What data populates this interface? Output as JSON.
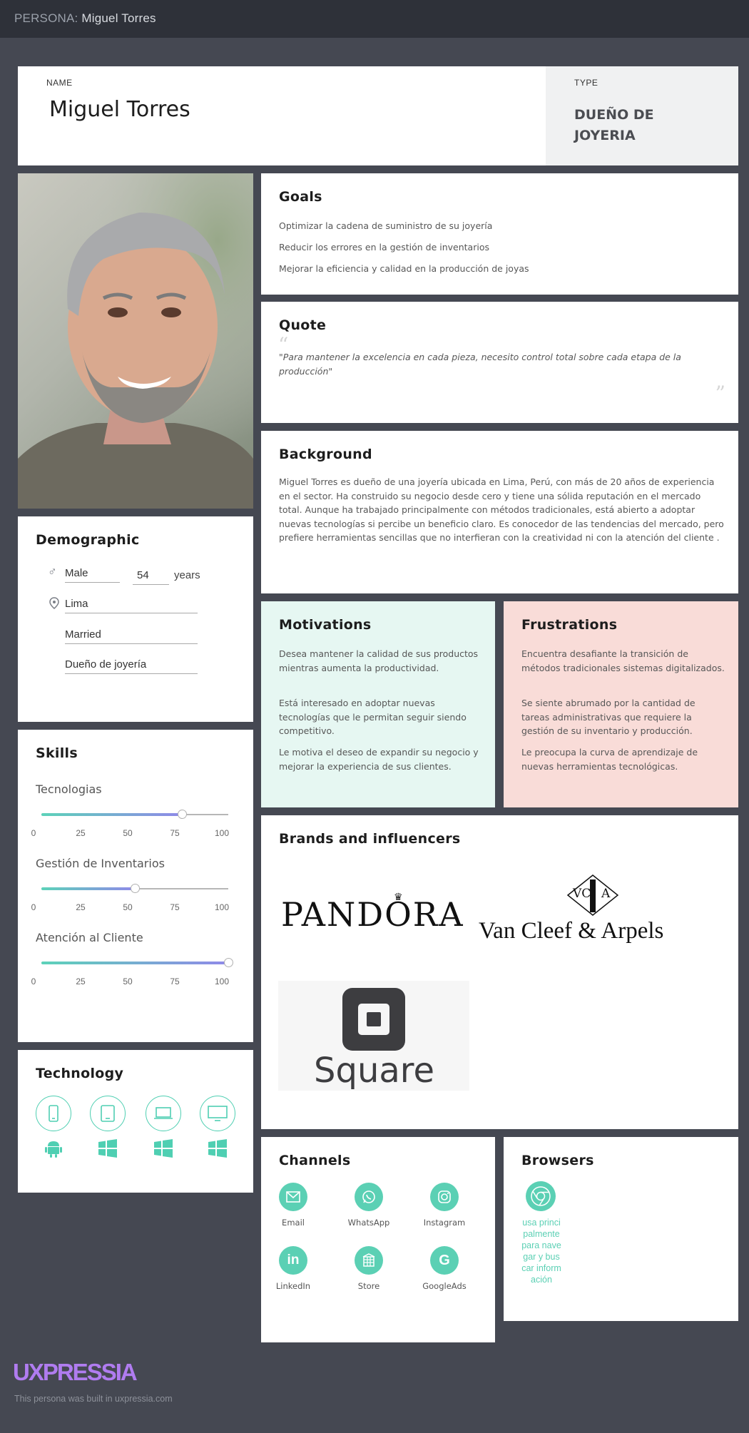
{
  "topbar": {
    "prefix": "PERSONA:",
    "name": "Miguel Torres"
  },
  "header": {
    "name_label": "NAME",
    "name": "Miguel Torres",
    "type_label": "TYPE",
    "type_line1": "DUEÑO DE",
    "type_line2": "JOYERIA"
  },
  "goals": {
    "title": "Goals",
    "items": [
      "Optimizar la cadena de suministro de su joyería",
      "Reducir los errores en la gestión de inventarios",
      "Mejorar la eficiencia y calidad en la producción de joyas"
    ]
  },
  "quote": {
    "title": "Quote",
    "text": "\"Para mantener la excelencia en cada pieza, necesito control total sobre cada etapa de la producción\""
  },
  "background": {
    "title": "Background",
    "text": "Miguel Torres es dueño de una joyería ubicada en Lima, Perú, con más de 20 años de experiencia en el sector. Ha construido su negocio desde cero y tiene una sólida reputación en el mercado total. Aunque ha trabajado principalmente con métodos tradicionales, está abierto a adoptar nuevas tecnologías si percibe un beneficio claro. Es conocedor de las tendencias del mercado, pero prefiere herramientas sencillas que no interfieran con la creatividad ni con la atención del cliente ."
  },
  "demographic": {
    "title": "Demographic",
    "gender": "Male",
    "age": "54",
    "age_unit": "years",
    "location": "Lima",
    "status": "Married",
    "occupation": "Dueño de joyería"
  },
  "motivations": {
    "title": "Motivations",
    "items": [
      "Desea mantener la calidad de sus productos mientras aumenta la productividad.",
      "Está interesado en adoptar nuevas tecnologías que le permitan seguir siendo competitivo.",
      "Le motiva el deseo de expandir su negocio y mejorar la experiencia de sus clientes."
    ]
  },
  "frustrations": {
    "title": "Frustrations",
    "items": [
      "Encuentra desafiante la transición de métodos tradicionales sistemas digitalizados.",
      "Se siente abrumado por la cantidad de tareas administrativas que requiere la gestión de su inventario y producción.",
      "Le preocupa la curva de aprendizaje de nuevas herramientas tecnológicas."
    ]
  },
  "skills": {
    "title": "Skills",
    "ticks": [
      "0",
      "25",
      "50",
      "75",
      "100"
    ],
    "items": [
      {
        "name": "Tecnologias",
        "value": 75
      },
      {
        "name": "Gestión de Inventarios",
        "value": 50
      },
      {
        "name": "Atención al Cliente",
        "value": 100
      }
    ]
  },
  "technology": {
    "title": "Technology",
    "devices": [
      "smartphone-icon",
      "tablet-icon",
      "laptop-icon",
      "desktop-icon"
    ],
    "os": [
      "android-icon",
      "windows-icon",
      "windows-icon",
      "windows-icon"
    ]
  },
  "brands": {
    "title": "Brands and influencers",
    "pandora": "PANDORA",
    "vca_mono_left": "VC",
    "vca_mono_right": "A",
    "vca_name": "Van Cleef & Arpels",
    "square": "Square"
  },
  "channels": {
    "title": "Channels",
    "items": [
      "Email",
      "WhatsApp",
      "Instagram",
      "LinkedIn",
      "Store",
      "GoogleAds"
    ]
  },
  "browsers": {
    "title": "Browsers",
    "note": "usa principalmente para navegar y buscar información"
  },
  "footer": {
    "brand": "UXPRESSIA",
    "text": "This persona was built in uxpressia.com"
  },
  "colors": {
    "accent": "#5bd0b4",
    "motivations_bg": "#e6f7f2",
    "frustrations_bg": "#f9dcd8",
    "brand_purple": "#b07cf0"
  }
}
